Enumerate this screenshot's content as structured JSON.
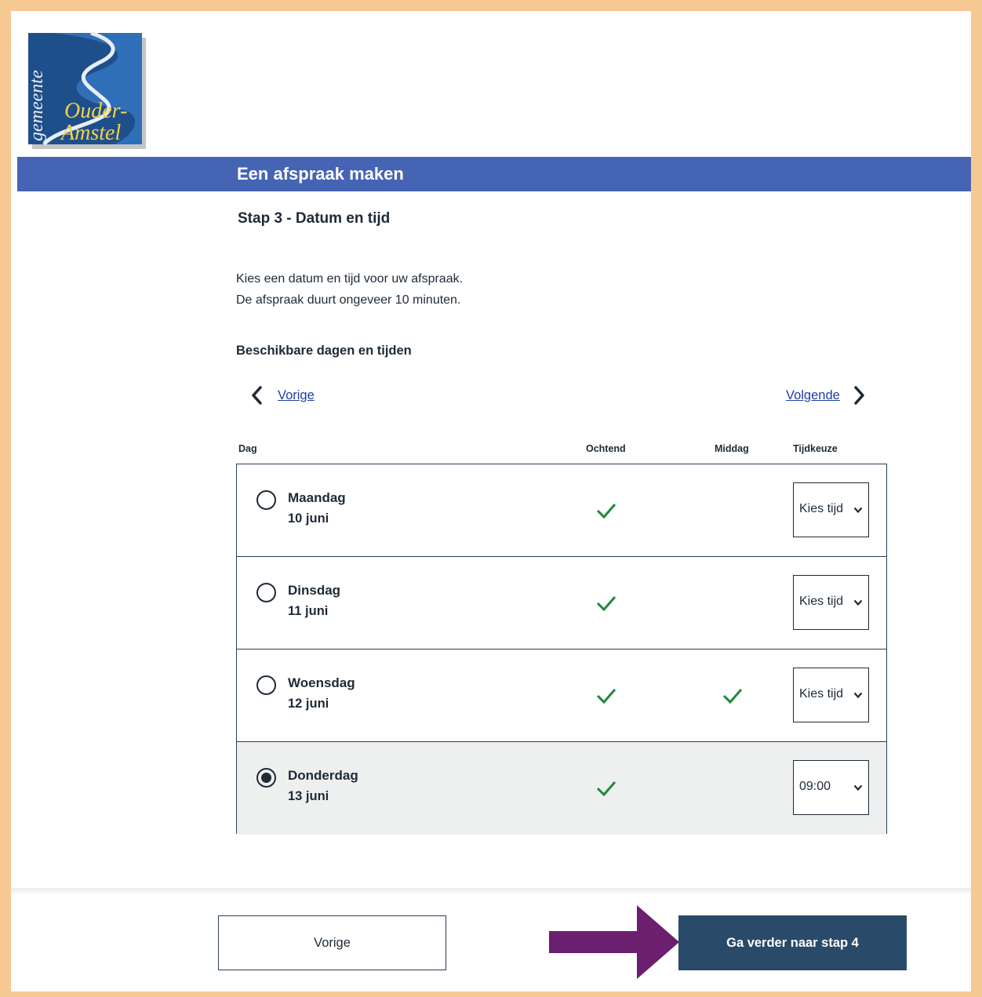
{
  "logo": {
    "line1": "gemeente",
    "line2": "Ouder-",
    "line3": "Amstel"
  },
  "banner": {
    "title": "Een afspraak maken"
  },
  "step": {
    "title": "Stap 3 - Datum en tijd"
  },
  "intro": {
    "line1": "Kies een datum en tijd voor uw afspraak.",
    "line2": "De afspraak duurt ongeveer 10 minuten."
  },
  "availability": {
    "title": "Beschikbare dagen en tijden",
    "prev_label": "Vorige",
    "next_label": "Volgende"
  },
  "table": {
    "headers": {
      "day": "Dag",
      "morning": "Ochtend",
      "afternoon": "Middag",
      "time_choice": "Tijdkeuze"
    },
    "rows": [
      {
        "day": "Maandag",
        "date": "10 juni",
        "morning": true,
        "afternoon": false,
        "time": "Kies tijd",
        "selected": false
      },
      {
        "day": "Dinsdag",
        "date": "11 juni",
        "morning": true,
        "afternoon": false,
        "time": "Kies tijd",
        "selected": false
      },
      {
        "day": "Woensdag",
        "date": "12 juni",
        "morning": true,
        "afternoon": true,
        "time": "Kies tijd",
        "selected": false
      },
      {
        "day": "Donderdag",
        "date": "13 juni",
        "morning": true,
        "afternoon": false,
        "time": "09:00",
        "selected": true
      }
    ]
  },
  "footer": {
    "back_label": "Vorige",
    "continue_label": "Ga verder naar stap 4"
  },
  "colors": {
    "outer_border": "#f6c992",
    "banner": "#4664b4",
    "primary_button": "#2a4a6a",
    "check": "#1f8a3c",
    "link": "#1e3ea8",
    "annotation_arrow": "#6b1f6e"
  }
}
